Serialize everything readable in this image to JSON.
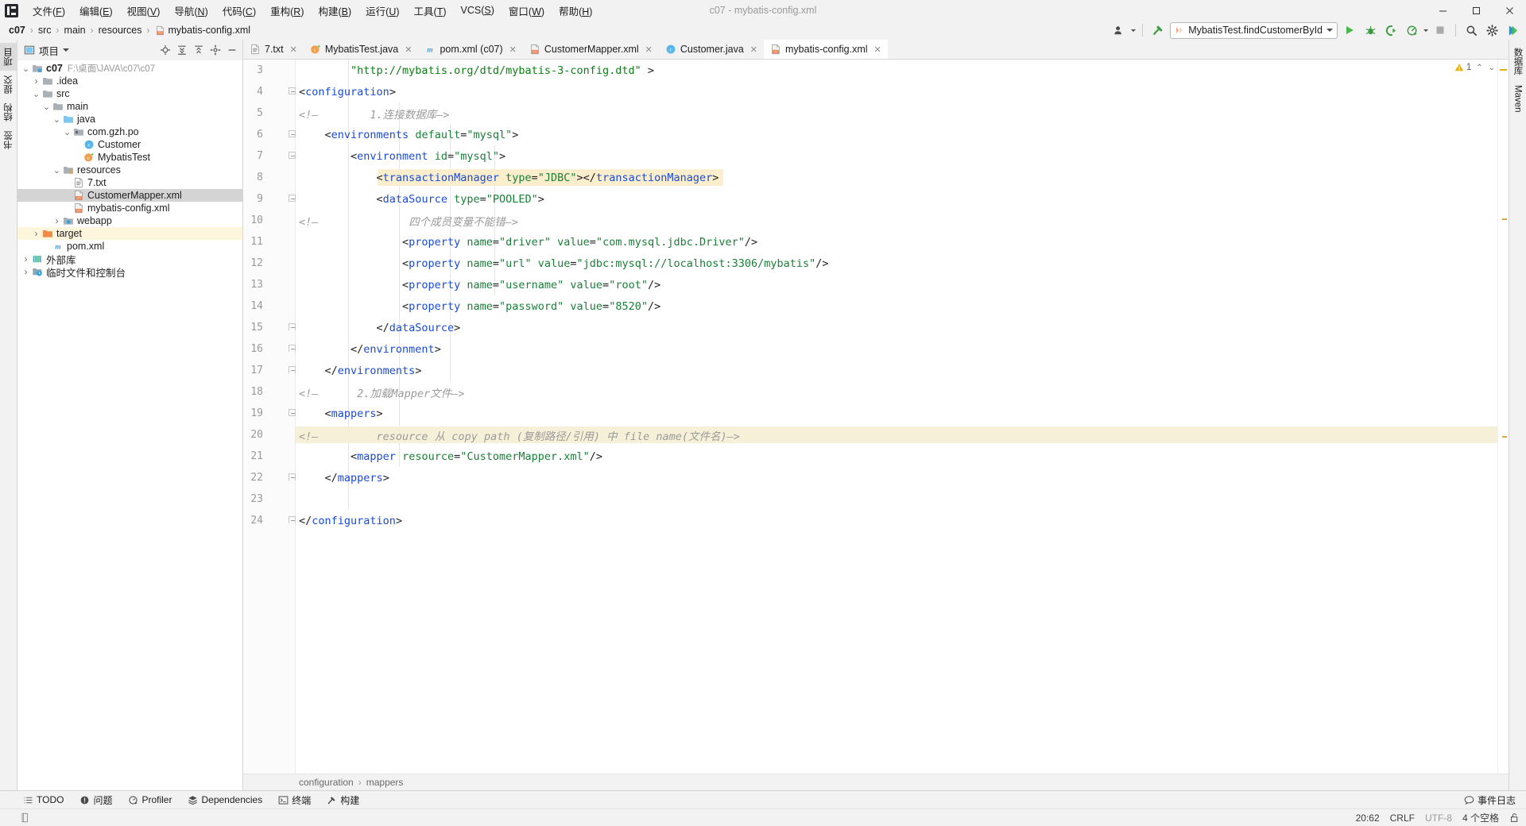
{
  "window": {
    "title": "c07 - mybatis-config.xml",
    "minimize": "—",
    "maximize": "▢",
    "close": "✕"
  },
  "menubar": {
    "items": [
      {
        "label": "文件(F)"
      },
      {
        "label": "编辑(E)"
      },
      {
        "label": "视图(V)"
      },
      {
        "label": "导航(N)"
      },
      {
        "label": "代码(C)"
      },
      {
        "label": "重构(R)"
      },
      {
        "label": "构建(B)"
      },
      {
        "label": "运行(U)"
      },
      {
        "label": "工具(T)"
      },
      {
        "label": "VCS(S)"
      },
      {
        "label": "窗口(W)"
      },
      {
        "label": "帮助(H)"
      }
    ]
  },
  "navbar": {
    "crumbs": [
      "c07",
      "src",
      "main",
      "resources",
      "mybatis-config.xml"
    ],
    "separator": "›",
    "run_config": "MybatisTest.findCustomerById",
    "icons": {
      "vcs_user": "user-icon",
      "build": "build-hammer-icon",
      "run": "run-icon",
      "debug": "debug-icon",
      "coverage": "run-with-coverage-icon",
      "profile": "profile-icon",
      "stop": "stop-icon",
      "search": "search-icon",
      "settings": "gear-icon",
      "ide_help": "ide-assistant-icon"
    }
  },
  "left_strip": {
    "tabs": [
      {
        "label": "项目",
        "icon": "project-icon",
        "active": true
      },
      {
        "label": "提交",
        "icon": "commit-icon",
        "active": false
      },
      {
        "label": "结构",
        "icon": "structure-icon",
        "active": false
      },
      {
        "label": "书签",
        "icon": "bookmark-icon",
        "active": false
      }
    ]
  },
  "right_strip": {
    "tabs": [
      {
        "label": "数据库",
        "icon": "database-icon"
      },
      {
        "label": "Maven",
        "icon": "maven-icon"
      }
    ]
  },
  "project_panel": {
    "title": "项目",
    "header_icons": [
      "locate-icon",
      "expand-all-icon",
      "collapse-all-icon",
      "settings-icon",
      "hide-icon"
    ],
    "tree": [
      {
        "depth": 0,
        "arrow": "▾",
        "icon": "module-icon",
        "label": "c07",
        "bold": true,
        "path": "F:\\桌面\\JAVA\\c07\\c07",
        "state": "normal"
      },
      {
        "depth": 1,
        "arrow": "›",
        "icon": "folder-icon",
        "label": ".idea",
        "path": "",
        "state": "normal"
      },
      {
        "depth": 1,
        "arrow": "▾",
        "icon": "folder-icon",
        "label": "src",
        "path": "",
        "state": "normal"
      },
      {
        "depth": 2,
        "arrow": "▾",
        "icon": "folder-icon",
        "label": "main",
        "path": "",
        "state": "normal"
      },
      {
        "depth": 3,
        "arrow": "▾",
        "icon": "source-folder-icon",
        "label": "java",
        "path": "",
        "state": "normal"
      },
      {
        "depth": 4,
        "arrow": "▾",
        "icon": "package-icon",
        "label": "com.gzh.po",
        "path": "",
        "state": "normal"
      },
      {
        "depth": 5,
        "arrow": "",
        "icon": "class-icon",
        "label": "Customer",
        "path": "",
        "state": "normal"
      },
      {
        "depth": 5,
        "arrow": "",
        "icon": "test-class-icon",
        "label": "MybatisTest",
        "path": "",
        "state": "normal"
      },
      {
        "depth": 3,
        "arrow": "▾",
        "icon": "resource-folder-icon",
        "label": "resources",
        "path": "",
        "state": "normal"
      },
      {
        "depth": 4,
        "arrow": "",
        "icon": "text-file-icon",
        "label": "7.txt",
        "path": "",
        "state": "normal"
      },
      {
        "depth": 4,
        "arrow": "",
        "icon": "xml-file-icon",
        "label": "CustomerMapper.xml",
        "path": "",
        "state": "selected"
      },
      {
        "depth": 4,
        "arrow": "",
        "icon": "xml-file-icon",
        "label": "mybatis-config.xml",
        "path": "",
        "state": "normal"
      },
      {
        "depth": 3,
        "arrow": "›",
        "icon": "webapp-folder-icon",
        "label": "webapp",
        "path": "",
        "state": "normal"
      },
      {
        "depth": 1,
        "arrow": "›",
        "icon": "target-folder-icon",
        "label": "target",
        "path": "",
        "state": "highlight"
      },
      {
        "depth": 2,
        "arrow": "",
        "icon": "maven-file-icon",
        "label": "pom.xml",
        "path": "",
        "state": "normal"
      },
      {
        "depth": 0,
        "arrow": "›",
        "icon": "external-libraries-icon",
        "label": "外部库",
        "path": "",
        "state": "normal"
      },
      {
        "depth": 0,
        "arrow": "›",
        "icon": "scratches-icon",
        "label": "临时文件和控制台",
        "path": "",
        "state": "normal"
      }
    ]
  },
  "editor_tabs": [
    {
      "label": "7.txt",
      "icon": "text-file-icon",
      "active": false
    },
    {
      "label": "MybatisTest.java",
      "icon": "test-class-icon",
      "active": false
    },
    {
      "label": "pom.xml (c07)",
      "icon": "maven-file-icon",
      "active": false
    },
    {
      "label": "CustomerMapper.xml",
      "icon": "xml-file-icon",
      "active": false
    },
    {
      "label": "Customer.java",
      "icon": "class-icon",
      "active": false
    },
    {
      "label": "mybatis-config.xml",
      "icon": "xml-file-icon",
      "active": true
    }
  ],
  "editor": {
    "warning_count": "1",
    "warning_icon": "warning-triangle-icon",
    "up_arrow": "⌃",
    "down_arrow": "⌄",
    "first_visible_line": 3,
    "lines": [
      {
        "n": 3,
        "fold": "",
        "tokens": [
          {
            "t": "        ",
            "c": "plain"
          },
          {
            "t": "\"http://mybatis.org/dtd/mybatis-3-config.dtd\"",
            "c": "str"
          },
          {
            "t": " >",
            "c": "dark"
          }
        ]
      },
      {
        "n": 4,
        "fold": "start",
        "tokens": [
          {
            "t": "<",
            "c": "dark"
          },
          {
            "t": "configuration",
            "c": "tag"
          },
          {
            "t": ">",
            "c": "dark"
          }
        ]
      },
      {
        "n": 5,
        "fold": "",
        "tokens": [
          {
            "t": "<!—        1.连接数据库—>",
            "c": "cmt"
          }
        ]
      },
      {
        "n": 6,
        "fold": "start",
        "tokens": [
          {
            "t": "    <",
            "c": "dark"
          },
          {
            "t": "environments ",
            "c": "tag"
          },
          {
            "t": "default",
            "c": "attr"
          },
          {
            "t": "=",
            "c": "dark"
          },
          {
            "t": "\"mysql\"",
            "c": "val"
          },
          {
            "t": ">",
            "c": "dark"
          }
        ]
      },
      {
        "n": 7,
        "fold": "start",
        "tokens": [
          {
            "t": "        <",
            "c": "dark"
          },
          {
            "t": "environment ",
            "c": "tag"
          },
          {
            "t": "id",
            "c": "attr"
          },
          {
            "t": "=",
            "c": "dark"
          },
          {
            "t": "\"mysql\"",
            "c": "val"
          },
          {
            "t": ">",
            "c": "dark"
          }
        ]
      },
      {
        "n": 8,
        "fold": "",
        "highlight": true,
        "tokens": [
          {
            "t": "            <",
            "c": "dark"
          },
          {
            "t": "transactionManager ",
            "c": "tag"
          },
          {
            "t": "type",
            "c": "attr"
          },
          {
            "t": "=",
            "c": "dark"
          },
          {
            "t": "\"JDBC\"",
            "c": "val"
          },
          {
            "t": "></",
            "c": "dark"
          },
          {
            "t": "transactionManager",
            "c": "tag"
          },
          {
            "t": ">",
            "c": "dark"
          }
        ]
      },
      {
        "n": 9,
        "fold": "start",
        "tokens": [
          {
            "t": "            <",
            "c": "dark"
          },
          {
            "t": "dataSource ",
            "c": "tag"
          },
          {
            "t": "type",
            "c": "attr"
          },
          {
            "t": "=",
            "c": "dark"
          },
          {
            "t": "\"POOLED\"",
            "c": "val"
          },
          {
            "t": ">",
            "c": "dark"
          }
        ]
      },
      {
        "n": 10,
        "fold": "",
        "tokens": [
          {
            "t": "<!—              四个成员变量不能错—>",
            "c": "cmt"
          }
        ]
      },
      {
        "n": 11,
        "fold": "",
        "tokens": [
          {
            "t": "                <",
            "c": "dark"
          },
          {
            "t": "property ",
            "c": "tag"
          },
          {
            "t": "name",
            "c": "attr"
          },
          {
            "t": "=",
            "c": "dark"
          },
          {
            "t": "\"driver\"",
            "c": "val"
          },
          {
            "t": " ",
            "c": "dark"
          },
          {
            "t": "value",
            "c": "attr"
          },
          {
            "t": "=",
            "c": "dark"
          },
          {
            "t": "\"com.mysql.jdbc.Driver\"",
            "c": "val"
          },
          {
            "t": "/>",
            "c": "dark"
          }
        ]
      },
      {
        "n": 12,
        "fold": "",
        "tokens": [
          {
            "t": "                <",
            "c": "dark"
          },
          {
            "t": "property ",
            "c": "tag"
          },
          {
            "t": "name",
            "c": "attr"
          },
          {
            "t": "=",
            "c": "dark"
          },
          {
            "t": "\"url\"",
            "c": "val"
          },
          {
            "t": " ",
            "c": "dark"
          },
          {
            "t": "value",
            "c": "attr"
          },
          {
            "t": "=",
            "c": "dark"
          },
          {
            "t": "\"jdbc:mysql://localhost:3306/mybatis\"",
            "c": "val"
          },
          {
            "t": "/>",
            "c": "dark"
          }
        ]
      },
      {
        "n": 13,
        "fold": "",
        "tokens": [
          {
            "t": "                <",
            "c": "dark"
          },
          {
            "t": "property ",
            "c": "tag"
          },
          {
            "t": "name",
            "c": "attr"
          },
          {
            "t": "=",
            "c": "dark"
          },
          {
            "t": "\"username\"",
            "c": "val"
          },
          {
            "t": " ",
            "c": "dark"
          },
          {
            "t": "value",
            "c": "attr"
          },
          {
            "t": "=",
            "c": "dark"
          },
          {
            "t": "\"root\"",
            "c": "val"
          },
          {
            "t": "/>",
            "c": "dark"
          }
        ]
      },
      {
        "n": 14,
        "fold": "",
        "tokens": [
          {
            "t": "                <",
            "c": "dark"
          },
          {
            "t": "property ",
            "c": "tag"
          },
          {
            "t": "name",
            "c": "attr"
          },
          {
            "t": "=",
            "c": "dark"
          },
          {
            "t": "\"password\"",
            "c": "val"
          },
          {
            "t": " ",
            "c": "dark"
          },
          {
            "t": "value",
            "c": "attr"
          },
          {
            "t": "=",
            "c": "dark"
          },
          {
            "t": "\"8520\"",
            "c": "val"
          },
          {
            "t": "/>",
            "c": "dark"
          }
        ]
      },
      {
        "n": 15,
        "fold": "end",
        "tokens": [
          {
            "t": "            </",
            "c": "dark"
          },
          {
            "t": "dataSource",
            "c": "tag"
          },
          {
            "t": ">",
            "c": "dark"
          }
        ]
      },
      {
        "n": 16,
        "fold": "end",
        "tokens": [
          {
            "t": "        </",
            "c": "dark"
          },
          {
            "t": "environment",
            "c": "tag"
          },
          {
            "t": ">",
            "c": "dark"
          }
        ]
      },
      {
        "n": 17,
        "fold": "end",
        "tokens": [
          {
            "t": "    </",
            "c": "dark"
          },
          {
            "t": "environments",
            "c": "tag"
          },
          {
            "t": ">",
            "c": "dark"
          }
        ]
      },
      {
        "n": 18,
        "fold": "",
        "tokens": [
          {
            "t": "<!—      2.加载Mapper文件—>",
            "c": "cmt"
          }
        ]
      },
      {
        "n": 19,
        "fold": "start",
        "bulb": true,
        "tokens": [
          {
            "t": "    <",
            "c": "dark"
          },
          {
            "t": "mappers",
            "c": "tag"
          },
          {
            "t": ">",
            "c": "dark"
          }
        ]
      },
      {
        "n": 20,
        "fold": "",
        "highlight_full": true,
        "tokens": [
          {
            "t": "<!—         resource 从 copy path (复制路径/引用) 中 file name(文件名)—>",
            "c": "cmt"
          }
        ]
      },
      {
        "n": 21,
        "fold": "",
        "tokens": [
          {
            "t": "        <",
            "c": "dark"
          },
          {
            "t": "mapper ",
            "c": "tag"
          },
          {
            "t": "resource",
            "c": "attr"
          },
          {
            "t": "=",
            "c": "dark"
          },
          {
            "t": "\"CustomerMapper.xml\"",
            "c": "val"
          },
          {
            "t": "/>",
            "c": "dark"
          }
        ]
      },
      {
        "n": 22,
        "fold": "end",
        "tokens": [
          {
            "t": "    </",
            "c": "dark"
          },
          {
            "t": "mappers",
            "c": "tag"
          },
          {
            "t": ">",
            "c": "dark"
          }
        ]
      },
      {
        "n": 23,
        "fold": "",
        "tokens": [
          {
            "t": "",
            "c": "plain"
          }
        ]
      },
      {
        "n": 24,
        "fold": "end",
        "tokens": [
          {
            "t": "</",
            "c": "dark"
          },
          {
            "t": "configuration",
            "c": "tag"
          },
          {
            "t": ">",
            "c": "dark"
          }
        ]
      }
    ],
    "breadcrumb": [
      "configuration",
      "mappers"
    ],
    "breadcrumb_separator": "›"
  },
  "bottom_bar": {
    "tools": [
      {
        "label": "TODO",
        "icon": "todo-icon"
      },
      {
        "label": "问题",
        "icon": "problems-icon"
      },
      {
        "label": "Profiler",
        "icon": "profiler-icon"
      },
      {
        "label": "Dependencies",
        "icon": "dependencies-icon"
      },
      {
        "label": "终端",
        "icon": "terminal-icon"
      },
      {
        "label": "构建",
        "icon": "build-icon"
      }
    ],
    "event_log": "事件日志",
    "event_log_icon": "event-log-icon"
  },
  "status_bar": {
    "caret": "20:62",
    "line_separator": "CRLF",
    "encoding": "UTF-8",
    "indent": "4 个空格",
    "lock_icon": "unlocked-icon"
  },
  "colors": {
    "tag": "#1a4bd6",
    "attr": "#1a7f37",
    "value": "#0c8014",
    "comment": "#9a9a9a",
    "highlight_band": "#f7f0d9",
    "capsule": "#faeecd",
    "selection": "#d4d4d4",
    "target_highlight": "#fdf6dd",
    "accent_green": "#4caf50",
    "warning": "#eab000"
  }
}
